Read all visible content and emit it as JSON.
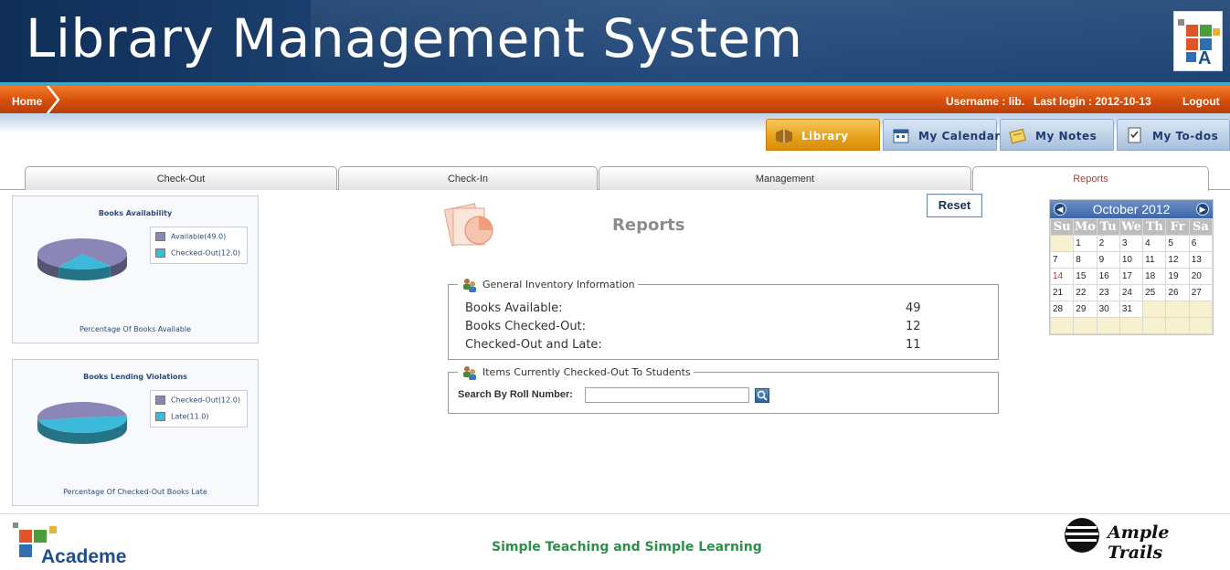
{
  "app": {
    "title": "Library Management System"
  },
  "nav": {
    "home": "Home",
    "user_info": "Username : lib.   Last login : 2012-10-13",
    "logout": "Logout"
  },
  "module_tabs": [
    {
      "label": "Library",
      "icon": "book-icon"
    },
    {
      "label": "My Calendar",
      "icon": "calendar-icon"
    },
    {
      "label": "My Notes",
      "icon": "notes-icon"
    },
    {
      "label": "My To-dos",
      "icon": "todo-icon"
    }
  ],
  "sub_tabs": [
    {
      "label": "Check-Out"
    },
    {
      "label": "Check-In"
    },
    {
      "label": "Management"
    },
    {
      "label": "Reports",
      "active": true
    }
  ],
  "charts": [
    {
      "title": "Books Availability",
      "footer": "Percentage Of Books Available",
      "legend": [
        "Available(49.0)",
        "Checked-Out(12.0)"
      ],
      "colors": [
        "#8b86b8",
        "#3bbad9"
      ]
    },
    {
      "title": "Books Lending Violations",
      "footer": "Percentage Of Checked-Out Books Late",
      "legend": [
        "Checked-Out(12.0)",
        "Late(11.0)"
      ],
      "colors": [
        "#8b86b8",
        "#3bbad9"
      ]
    }
  ],
  "chart_data": [
    {
      "type": "pie",
      "title": "Books Availability",
      "categories": [
        "Available",
        "Checked-Out"
      ],
      "values": [
        49.0,
        12.0
      ]
    },
    {
      "type": "pie",
      "title": "Books Lending Violations",
      "categories": [
        "Checked-Out",
        "Late"
      ],
      "values": [
        12.0,
        11.0
      ]
    }
  ],
  "reports": {
    "heading": "Reports",
    "reset_label": "Reset",
    "inventory": {
      "legend": "General Inventory Information",
      "rows": [
        {
          "label": "Books Available:",
          "value": "49"
        },
        {
          "label": "Books Checked-Out:",
          "value": "12"
        },
        {
          "label": "Checked-Out and Late:",
          "value": "11"
        }
      ]
    },
    "checked_out": {
      "legend": "Items Currently Checked-Out To Students",
      "search_label": "Search By Roll Number:",
      "search_value": ""
    }
  },
  "calendar": {
    "month": "October 2012",
    "days": [
      "Su",
      "Mo",
      "Tu",
      "We",
      "Th",
      "Fr",
      "Sa"
    ],
    "weeks": [
      [
        "",
        "1",
        "2",
        "3",
        "4",
        "5",
        "6"
      ],
      [
        "7",
        "8",
        "9",
        "10",
        "11",
        "12",
        "13"
      ],
      [
        "14",
        "15",
        "16",
        "17",
        "18",
        "19",
        "20"
      ],
      [
        "21",
        "22",
        "23",
        "24",
        "25",
        "26",
        "27"
      ],
      [
        "28",
        "29",
        "30",
        "31",
        "",
        "",
        ""
      ],
      [
        "",
        "",
        "",
        "",
        "",
        "",
        ""
      ]
    ],
    "highlight": "14"
  },
  "footer": {
    "brand": "Academe",
    "tagline": "Simple Teaching and Simple Learning",
    "partner": "Ample Trails"
  }
}
